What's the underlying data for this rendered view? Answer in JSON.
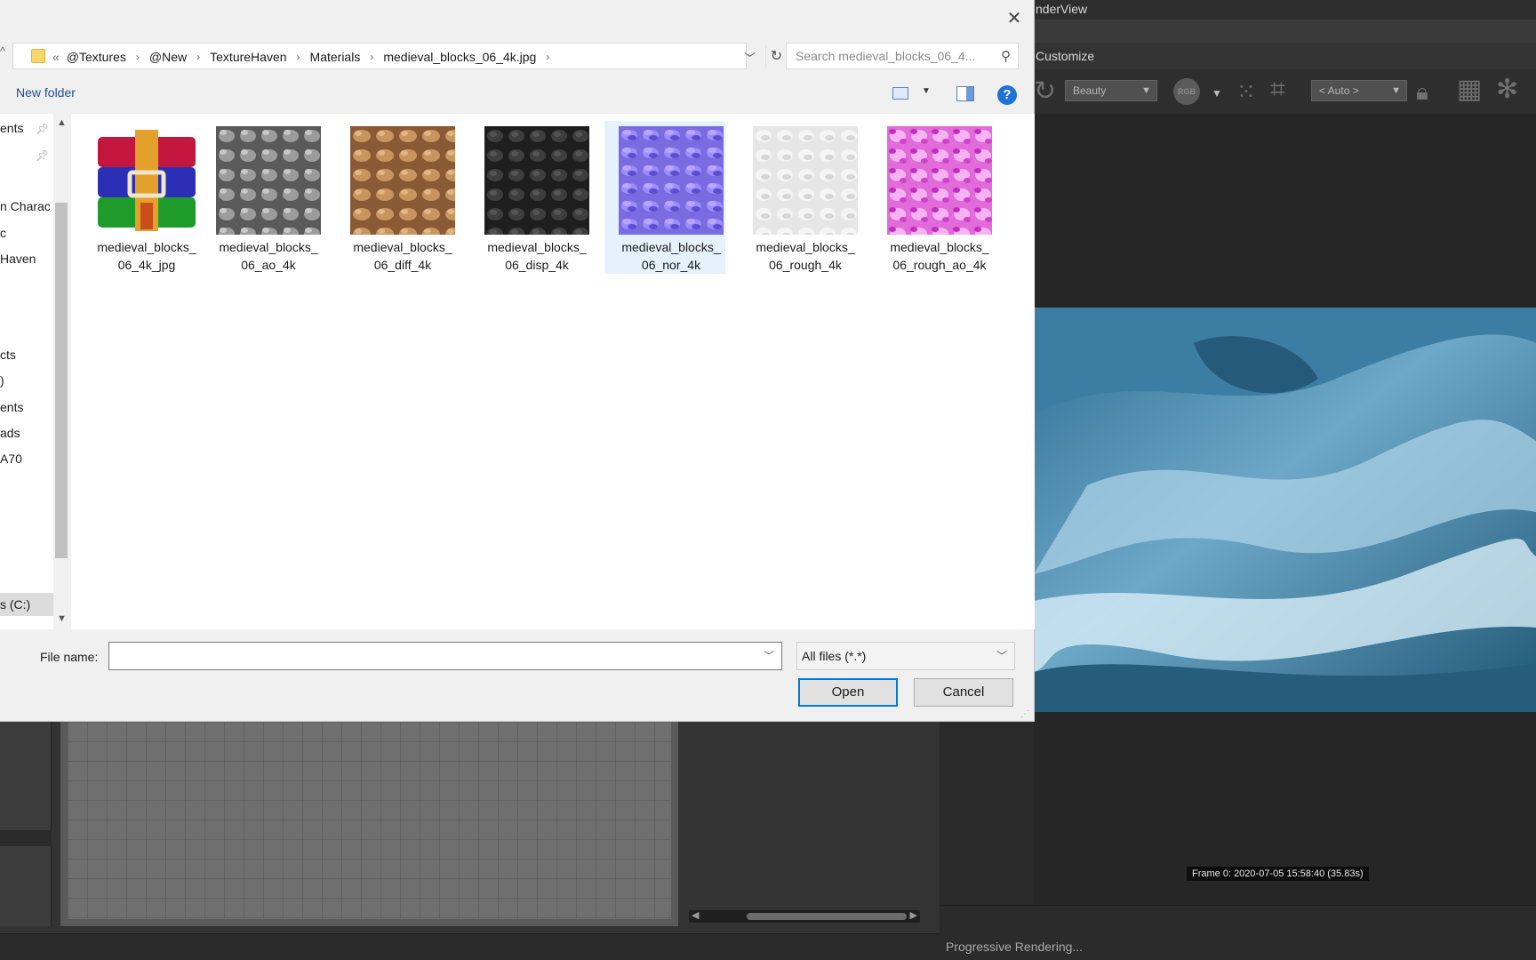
{
  "render_view": {
    "title": "nderView",
    "menu": "Customize",
    "beauty_select": "Beauty",
    "rgb_label": "RGB",
    "auto_select": "< Auto >",
    "frame_label": "Frame 0:  2020-07-05  15:58:40  (35.83s)",
    "status": "Progressive Rendering..."
  },
  "dialog": {
    "address": {
      "back_chevrons": "«",
      "crumbs": [
        "@Textures",
        "@New",
        "TextureHaven",
        "Materials",
        "medieval_blocks_06_4k.jpg"
      ]
    },
    "search_placeholder": "Search medieval_blocks_06_4...",
    "new_folder": "New folder",
    "help": "?",
    "nav_items": [
      {
        "label": "ents",
        "pinned": true
      },
      {
        "label": "",
        "pinned": true
      },
      {
        "label": "n Charac"
      },
      {
        "label": "c"
      },
      {
        "label": "Haven"
      },
      {
        "label": "cts"
      },
      {
        "label": ")"
      },
      {
        "label": "ents"
      },
      {
        "label": "ads"
      },
      {
        "label": "A70"
      },
      {
        "label": "s (C:)",
        "selected": true
      }
    ],
    "files": [
      {
        "line1": "medieval_blocks_",
        "line2": "06_4k_jpg",
        "thumb": "winrar-archive-icon"
      },
      {
        "line1": "medieval_blocks_",
        "line2": "06_ao_4k",
        "thumb": "ao-texture"
      },
      {
        "line1": "medieval_blocks_",
        "line2": "06_diff_4k",
        "thumb": "diffuse-texture"
      },
      {
        "line1": "medieval_blocks_",
        "line2": "06_disp_4k",
        "thumb": "displacement-texture"
      },
      {
        "line1": "medieval_blocks_",
        "line2": "06_nor_4k",
        "thumb": "normal-texture",
        "selected": true
      },
      {
        "line1": "medieval_blocks_",
        "line2": "06_rough_4k",
        "thumb": "roughness-texture"
      },
      {
        "line1": "medieval_blocks_",
        "line2": "06_rough_ao_4k",
        "thumb": "rough-ao-texture"
      }
    ],
    "file_name_label": "File name:",
    "file_name_value": "",
    "file_type": "All files (*.*)",
    "open_button": "Open",
    "cancel_button": "Cancel"
  },
  "colors": {
    "accent": "#0078d7",
    "link": "#1e4f91",
    "selection": "#e5f1fb"
  }
}
